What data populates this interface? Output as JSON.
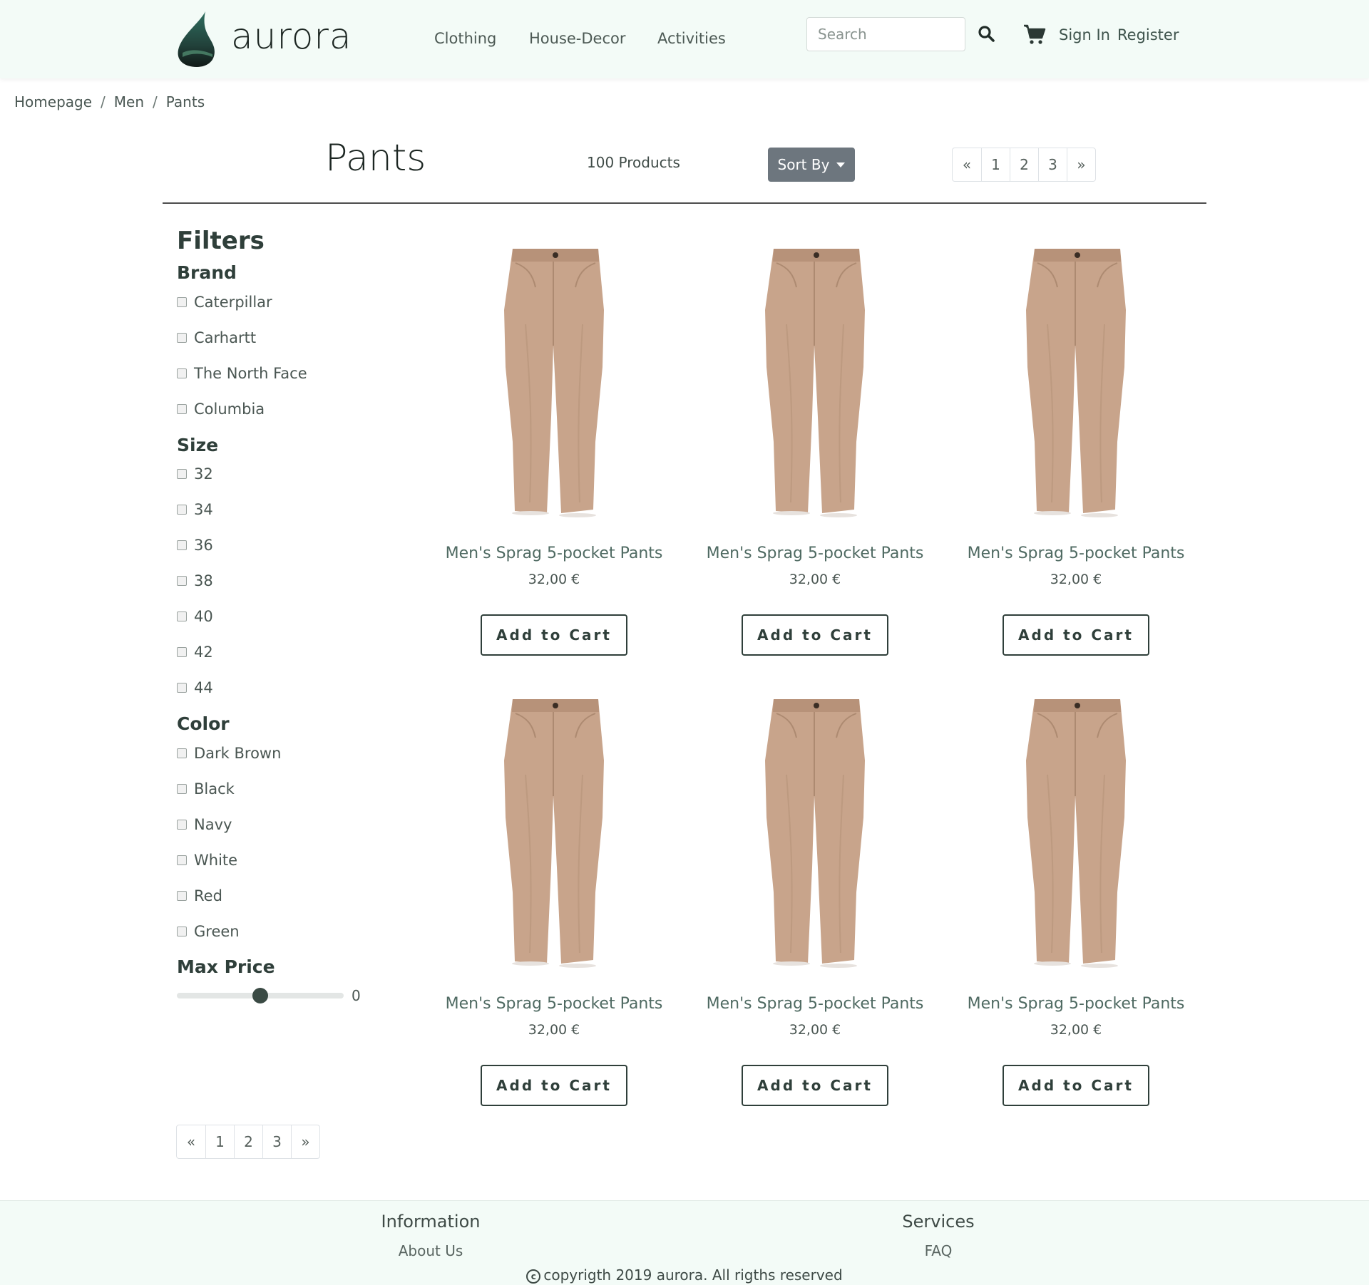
{
  "header": {
    "logo_text": "aurora",
    "nav": [
      "Clothing",
      "House-Decor",
      "Activities"
    ],
    "search_placeholder": "Search",
    "sign_in": "Sign In",
    "register": "Register"
  },
  "breadcrumb": [
    "Homepage",
    "Men",
    "Pants"
  ],
  "toolbar": {
    "title": "Pants",
    "count": "100 Products",
    "sort_label": "Sort By",
    "pages": [
      "«",
      "1",
      "2",
      "3",
      "»"
    ]
  },
  "filters": {
    "title": "Filters",
    "brand": {
      "heading": "Brand",
      "options": [
        "Caterpillar",
        "Carhartt",
        "The North Face",
        "Columbia"
      ]
    },
    "size": {
      "heading": "Size",
      "options": [
        "32",
        "34",
        "36",
        "38",
        "40",
        "42",
        "44"
      ]
    },
    "color": {
      "heading": "Color",
      "options": [
        "Dark Brown",
        "Black",
        "Navy",
        "White",
        "Red",
        "Green"
      ]
    },
    "price": {
      "heading": "Max Price",
      "value": "0",
      "slider_fraction": 0.5
    }
  },
  "products": [
    {
      "name": "Men's Sprag 5-pocket Pants",
      "price": "32,00 €",
      "button": "Add to Cart"
    },
    {
      "name": "Men's Sprag 5-pocket Pants",
      "price": "32,00 €",
      "button": "Add to Cart"
    },
    {
      "name": "Men's Sprag 5-pocket Pants",
      "price": "32,00 €",
      "button": "Add to Cart"
    },
    {
      "name": "Men's Sprag 5-pocket Pants",
      "price": "32,00 €",
      "button": "Add to Cart"
    },
    {
      "name": "Men's Sprag 5-pocket Pants",
      "price": "32,00 €",
      "button": "Add to Cart"
    },
    {
      "name": "Men's Sprag 5-pocket Pants",
      "price": "32,00 €",
      "button": "Add to Cart"
    }
  ],
  "footer": {
    "information": {
      "heading": "Information",
      "link": "About Us"
    },
    "services": {
      "heading": "Services",
      "link": "FAQ"
    },
    "copyright": "copyrigth 2019 aurora. All rigths reserved"
  },
  "colors": {
    "header_bg": "#f3fbf7",
    "accent_dark": "#2f3f3a",
    "sort_button": "#6d767e",
    "pants": "#c8a48b"
  },
  "icons": [
    "logo-drop-icon",
    "search-icon",
    "cart-icon",
    "copyright-icon"
  ]
}
